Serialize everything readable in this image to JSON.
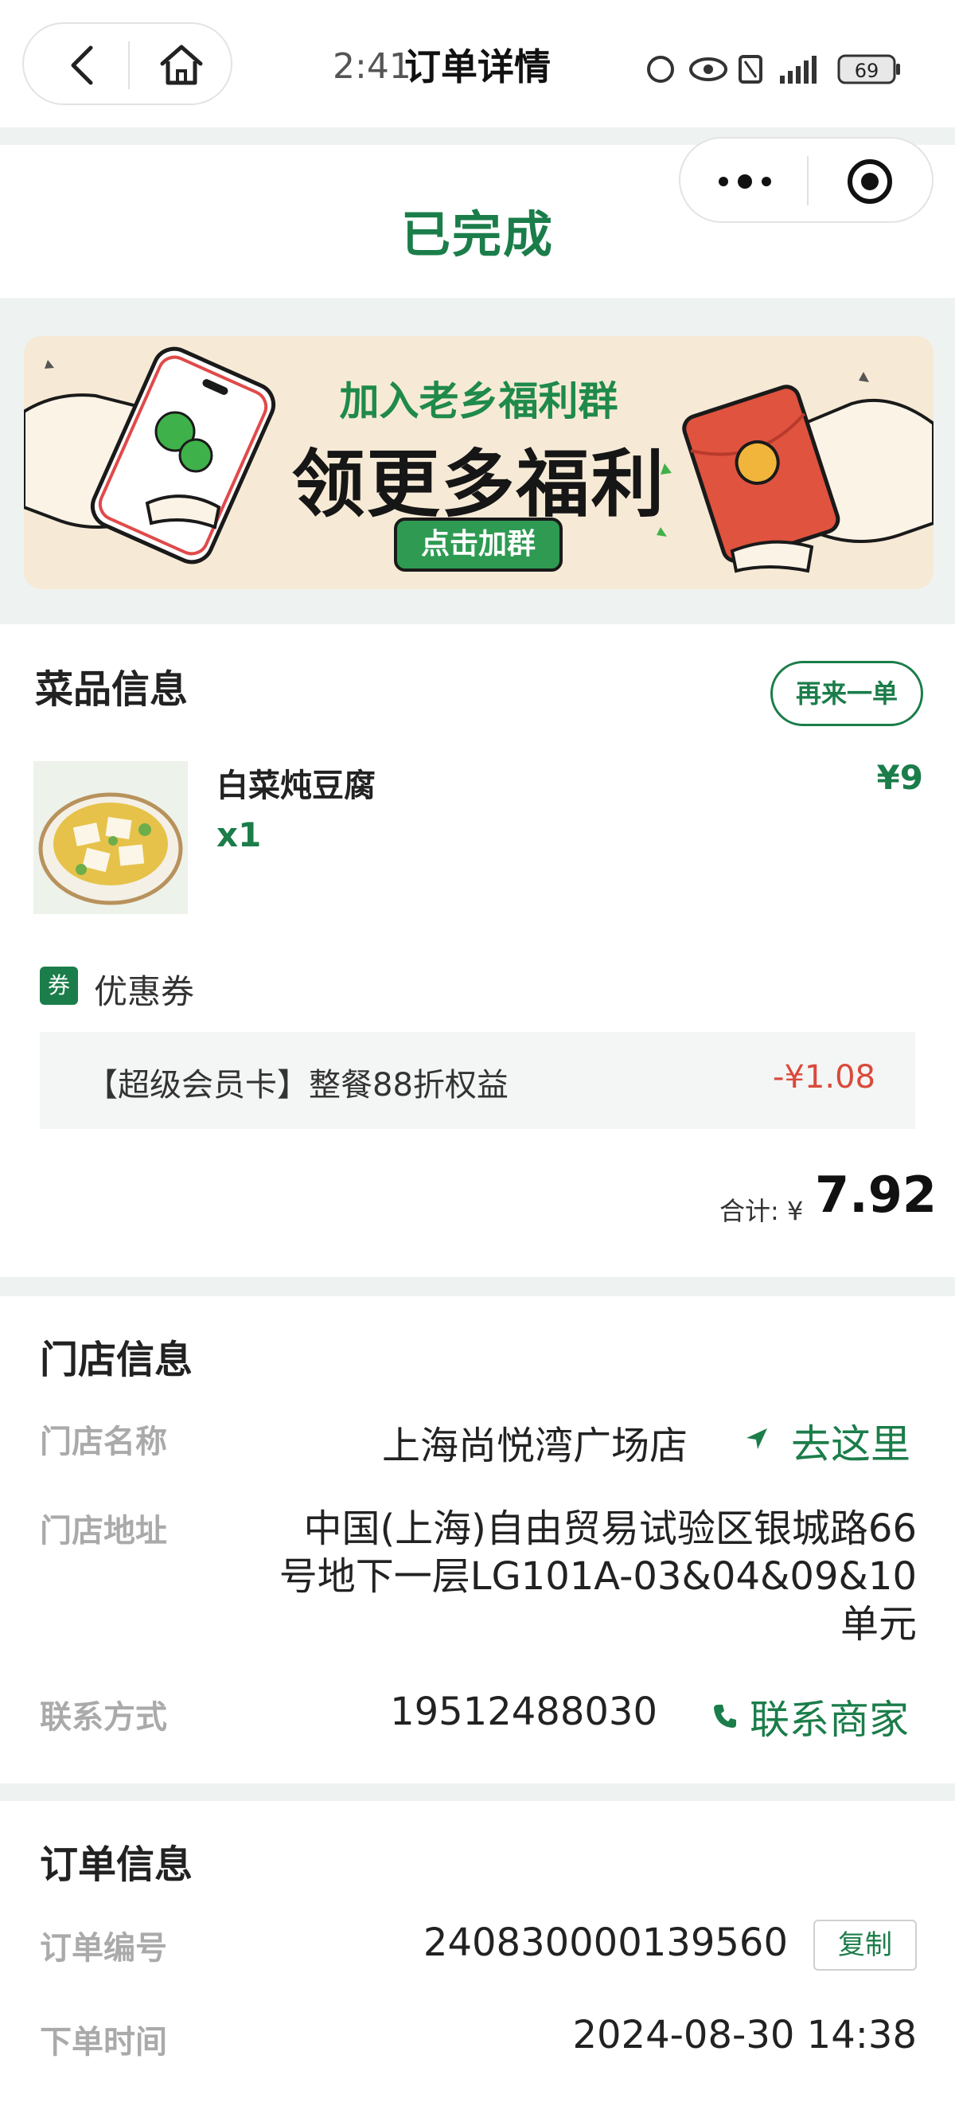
{
  "status_bar": {
    "time": "2:41",
    "battery": "69"
  },
  "header": {
    "title": "订单详情"
  },
  "order_status": {
    "label": "已完成"
  },
  "banner": {
    "line1": "加入老乡福利群",
    "line2": "领更多福利",
    "button_label": "点击加群"
  },
  "dishes": {
    "section_title": "菜品信息",
    "reorder_label": "再来一单",
    "items": [
      {
        "name": "白菜炖豆腐",
        "quantity": "x1",
        "price": "¥9"
      }
    ],
    "coupon": {
      "badge": "券",
      "label": "优惠券",
      "name": "【超级会员卡】整餐88折权益",
      "discount": "-¥1.08"
    },
    "total": {
      "label": "合计: ¥",
      "value": "7.92"
    }
  },
  "store": {
    "section_title": "门店信息",
    "name_label": "门店名称",
    "name": "上海尚悦湾广场店",
    "navigate_label": "去这里",
    "address_label": "门店地址",
    "address_lines": [
      "中国(上海)自由贸易试验区银城路66",
      "号地下一层LG101A-03&04&09&10",
      "单元"
    ],
    "contact_label": "联系方式",
    "phone": "19512488030",
    "contact_action": "联系商家"
  },
  "order": {
    "section_title": "订单信息",
    "number_label": "订单编号",
    "number": "240830000139560",
    "copy_label": "复制",
    "time_label": "下单时间",
    "time": "2024-08-30 14:38"
  },
  "colors": {
    "brand_green": "#1b7d4a",
    "discount_red": "#d94a3b",
    "page_bg": "#eef3f1"
  }
}
